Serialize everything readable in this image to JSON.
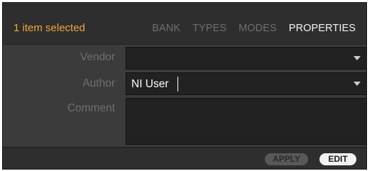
{
  "header": {
    "selection_status": "1 item selected",
    "tabs": [
      {
        "label": "BANK",
        "active": false
      },
      {
        "label": "TYPES",
        "active": false
      },
      {
        "label": "MODES",
        "active": false
      },
      {
        "label": "PROPERTIES",
        "active": true
      }
    ]
  },
  "form": {
    "vendor": {
      "label": "Vendor",
      "value": ""
    },
    "author": {
      "label": "Author",
      "value": "NI User"
    },
    "comment": {
      "label": "Comment",
      "value": ""
    }
  },
  "footer": {
    "apply_label": "APPLY",
    "edit_label": "EDIT"
  },
  "colors": {
    "selection_accent": "#f0a63b",
    "panel_background": "#3b3b3b",
    "field_background": "#222222",
    "active_tab": "#f4f4f4",
    "inactive_tab": "#6e6e6e"
  }
}
